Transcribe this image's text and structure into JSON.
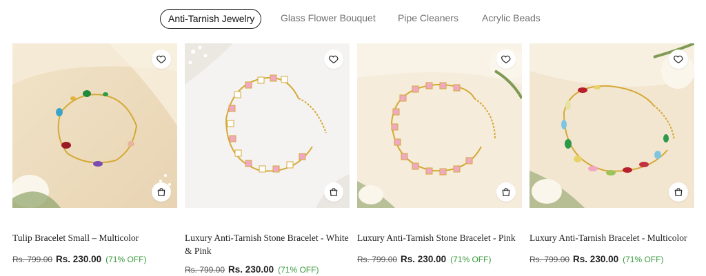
{
  "tabs": [
    {
      "label": "Anti-Tarnish Jewelry",
      "active": true
    },
    {
      "label": "Glass Flower Bouquet",
      "active": false
    },
    {
      "label": "Pipe Cleaners",
      "active": false
    },
    {
      "label": "Acrylic Beads",
      "active": false
    }
  ],
  "products": [
    {
      "title": "Tulip Bracelet Small – Multicolor",
      "mrp": "Rs. 799.00",
      "price": "Rs. 230.00",
      "discount": "(71% OFF)",
      "image": "multicolor-bracelet-cream-background"
    },
    {
      "title": "Luxury Anti-Tarnish Stone Bracelet - White & Pink",
      "mrp": "Rs. 799.00",
      "price": "Rs. 230.00",
      "discount": "(71% OFF)",
      "image": "pink-white-stone-bracelet-white-background"
    },
    {
      "title": "Luxury Anti-Tarnish Stone Bracelet - Pink",
      "mrp": "Rs. 799.00",
      "price": "Rs. 230.00",
      "discount": "(71% OFF)",
      "image": "pink-stone-bracelet-cream-background"
    },
    {
      "title": "Luxury Anti-Tarnish Bracelet - Multicolor",
      "mrp": "Rs. 799.00",
      "price": "Rs. 230.00",
      "discount": "(71% OFF)",
      "image": "multicolor-marquise-bracelet-cream-background"
    }
  ],
  "icons": {
    "wishlist": "heart-icon",
    "cart": "shopping-bag-icon"
  },
  "colors": {
    "discount": "#3a9a3e",
    "active_tab_border": "#222222"
  }
}
